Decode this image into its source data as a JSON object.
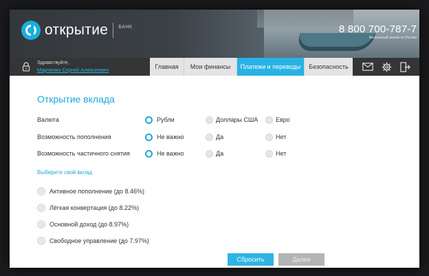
{
  "header": {
    "brand_name": "открытие",
    "brand_suffix": "БАНК",
    "phone": "8 800 700-787-7",
    "phone_note": "бесплатный звонок по России"
  },
  "user": {
    "greeting": "Здравствуйте,",
    "name": "Марченко Сергей Алексеевич"
  },
  "nav": {
    "tabs": [
      {
        "label": "Главная",
        "active": false
      },
      {
        "label": "Мои финансы",
        "active": false
      },
      {
        "label": "Платежи и переводы",
        "active": true
      },
      {
        "label": "Безопасность",
        "active": false
      }
    ],
    "icons": [
      "mail-icon",
      "settings-icon",
      "logout-icon"
    ]
  },
  "form": {
    "title": "Открытие вклада",
    "rows": [
      {
        "label": "Валюта",
        "options": [
          "Рубли",
          "Доллары США",
          "Евро"
        ],
        "selected": 0
      },
      {
        "label": "Возможность пополнения",
        "options": [
          "Не важно",
          "Да",
          "Нет"
        ],
        "selected": 0
      },
      {
        "label": "Возможность частичного снятия",
        "options": [
          "Не важно",
          "Да",
          "Нет"
        ],
        "selected": 0
      }
    ],
    "choose_link": "Выберите свой вклад",
    "deposits": [
      "Активное пополнение (до 8.46%)",
      "Лёгкая конвертация (до 8.22%)",
      "Основной доход (до 8.97%)",
      "Свободное управление (до 7.97%)"
    ],
    "reset_label": "Сбросить",
    "next_label": "Далее"
  },
  "colors": {
    "accent": "#1ea6dc",
    "nav_bg": "#333536",
    "tab_bg": "#e4e4e4",
    "disabled": "#b4b4b4"
  }
}
